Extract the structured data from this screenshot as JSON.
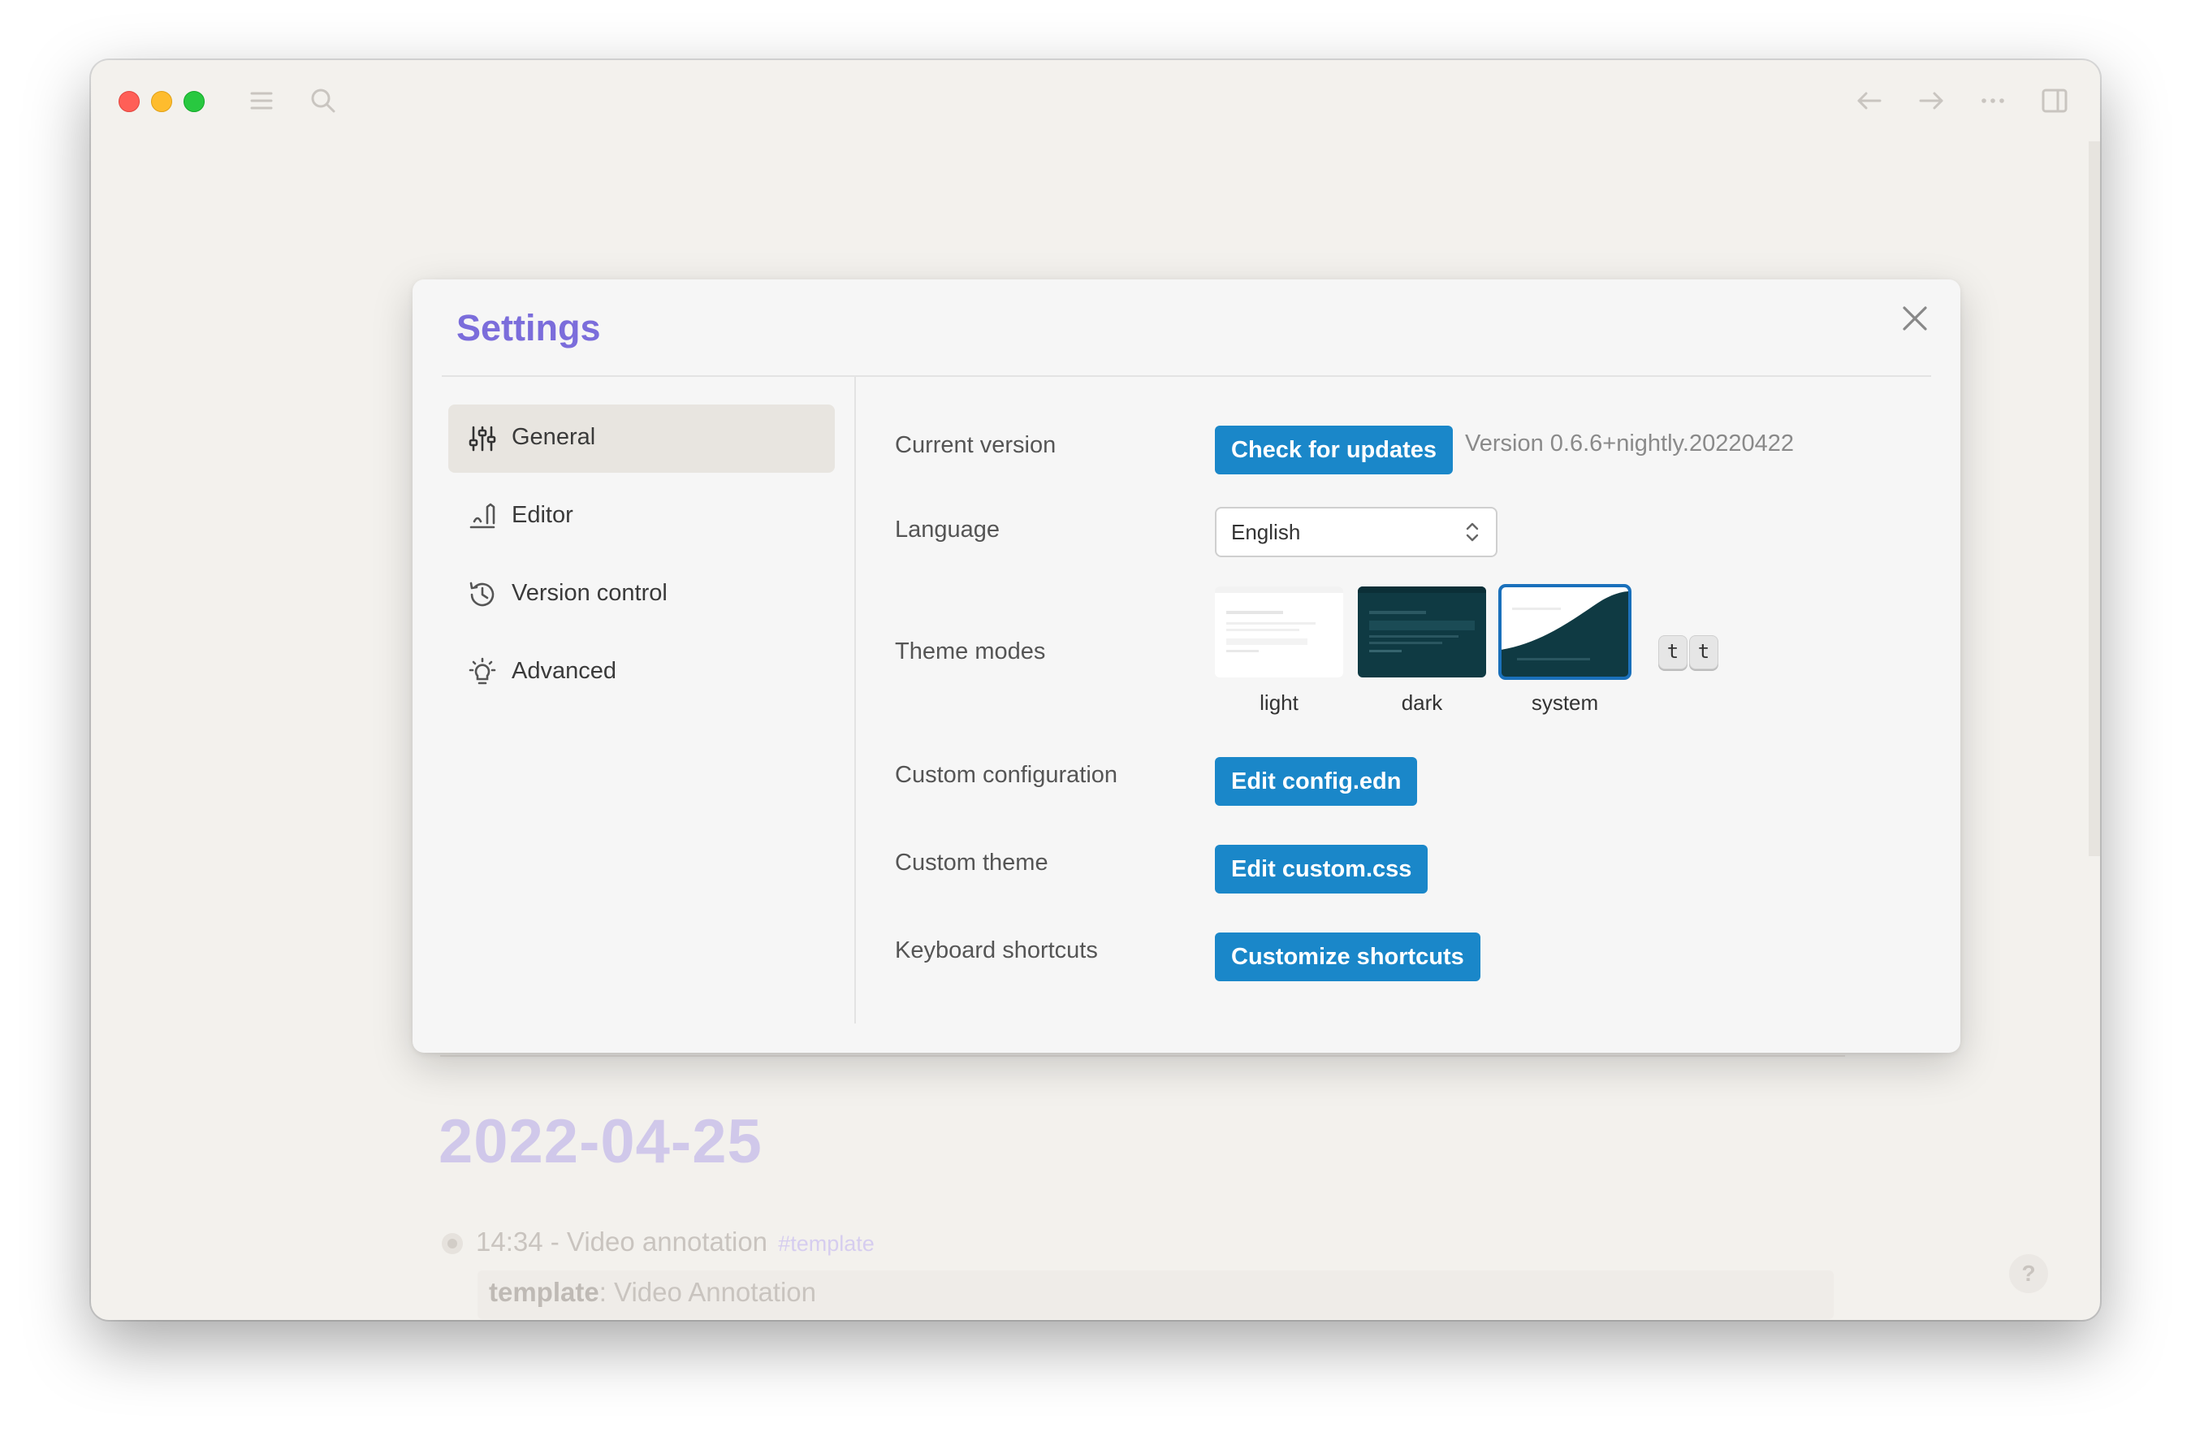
{
  "titlebar": {
    "icons": [
      "menu-icon",
      "search-icon",
      "arrow-left-icon",
      "arrow-right-icon",
      "more-icon",
      "sidebar-toggle-icon"
    ]
  },
  "settings": {
    "title": "Settings",
    "nav": [
      {
        "label": "General",
        "icon": "sliders-icon",
        "active": true
      },
      {
        "label": "Editor",
        "icon": "writing-icon",
        "active": false
      },
      {
        "label": "Version control",
        "icon": "history-icon",
        "active": false
      },
      {
        "label": "Advanced",
        "icon": "bulb-icon",
        "active": false
      }
    ],
    "rows": {
      "current_version": {
        "label": "Current version",
        "button": "Check for updates",
        "version": "Version 0.6.6+nightly.20220422"
      },
      "language": {
        "label": "Language",
        "value": "English"
      },
      "theme_modes": {
        "label": "Theme modes",
        "options": [
          "light",
          "dark",
          "system"
        ],
        "selected": "system",
        "shortcut_keys": [
          "t",
          "t"
        ]
      },
      "custom_configuration": {
        "label": "Custom configuration",
        "button": "Edit config.edn"
      },
      "custom_theme": {
        "label": "Custom theme",
        "button": "Edit custom.css"
      },
      "keyboard_shortcuts": {
        "label": "Keyboard shortcuts",
        "button": "Customize shortcuts"
      }
    }
  },
  "background_page": {
    "date_title": "2022-04-25",
    "block_text": "14:34 - Video annotation",
    "block_tag": "#template",
    "property_key": "template",
    "property_value": ": Video Annotation",
    "help_label": "?"
  },
  "colors": {
    "accent_title": "#7b6ddb",
    "button_blue": "#1a87c9",
    "window_bg": "#f3f1ed",
    "modal_bg": "#f6f6f6"
  }
}
